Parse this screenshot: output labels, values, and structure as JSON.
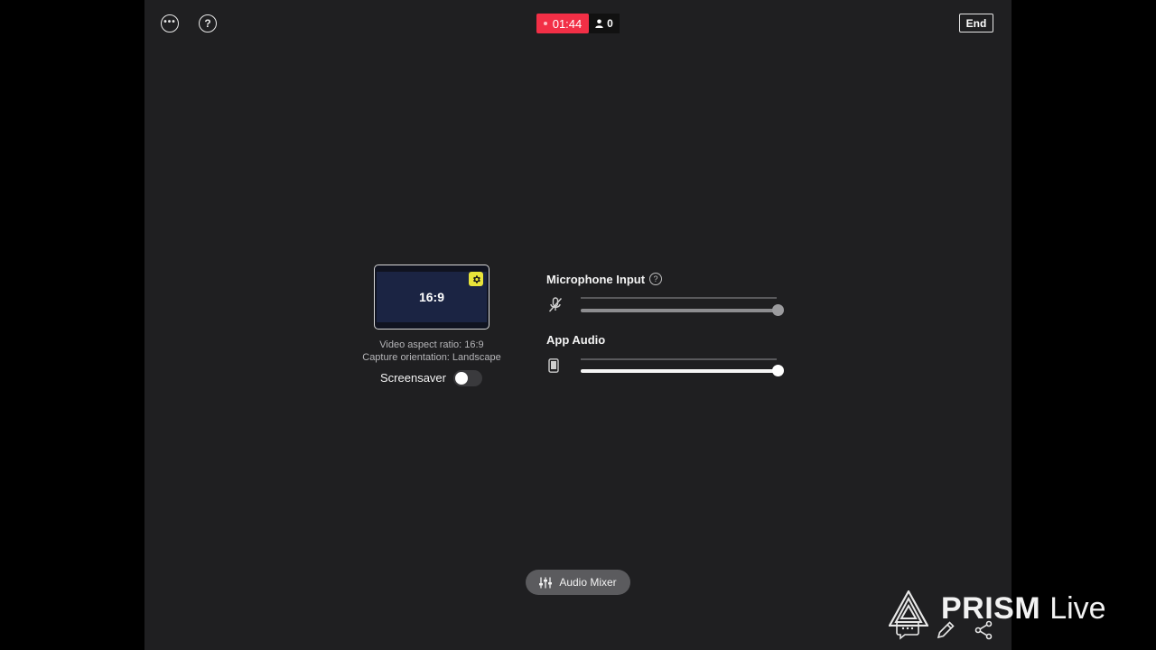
{
  "top_bar": {
    "more_icon": "more-icon",
    "help_icon": "help-icon",
    "help_glyph": "?",
    "recording_time": "01:44",
    "viewer_count": "0",
    "end_label": "End",
    "rec_color": "#f22f46"
  },
  "preview": {
    "aspect_label": "16:9",
    "settings_icon": "gear-icon",
    "badge_color": "#e9e43a",
    "info_aspect": "Video aspect ratio: 16:9",
    "info_orientation": "Capture orientation: Landscape",
    "screensaver_label": "Screensaver",
    "screensaver_on": false
  },
  "audio": {
    "microphone_label": "Microphone Input",
    "microphone_help": "?",
    "microphone_icon": "microphone-muted-icon",
    "microphone_level": 1.0,
    "app_audio_label": "App Audio",
    "app_audio_icon": "phone-icon",
    "app_audio_level": 1.0
  },
  "bottom": {
    "mixer_label": "Audio Mixer",
    "mixer_icon": "sliders-icon"
  },
  "branding": {
    "name": "PRISM",
    "suffix": "Live"
  },
  "overlay_icons": [
    "chat-icon",
    "pen-icon",
    "share-icon"
  ]
}
